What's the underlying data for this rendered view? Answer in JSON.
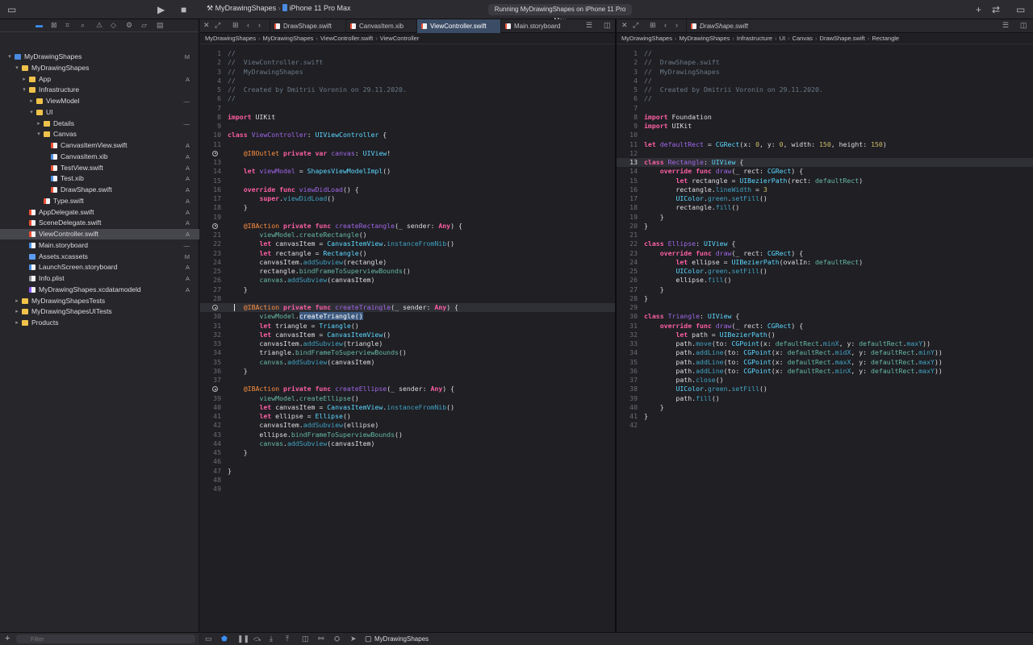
{
  "toolbar": {
    "scheme": "MyDrawingShapes",
    "device": "iPhone 11 Pro Max",
    "status": "Running MyDrawingShapes on iPhone 11 Pro Max"
  },
  "navigator": {
    "filter_placeholder": "Filter",
    "items": [
      {
        "label": "MyDrawingShapes",
        "badge": "M",
        "indent": 0,
        "icon": "proj",
        "tw": "▾"
      },
      {
        "label": "MyDrawingShapes",
        "badge": "",
        "indent": 1,
        "icon": "folder",
        "tw": "▾"
      },
      {
        "label": "App",
        "badge": "A",
        "indent": 2,
        "icon": "folder",
        "tw": "▸"
      },
      {
        "label": "Infrastructure",
        "badge": "",
        "indent": 2,
        "icon": "folder",
        "tw": "▾"
      },
      {
        "label": "ViewModel",
        "badge": "—",
        "indent": 3,
        "icon": "folder",
        "tw": "▸"
      },
      {
        "label": "UI",
        "badge": "",
        "indent": 3,
        "icon": "folder",
        "tw": "▾"
      },
      {
        "label": "Details",
        "badge": "—",
        "indent": 4,
        "icon": "folder",
        "tw": "▸"
      },
      {
        "label": "Canvas",
        "badge": "",
        "indent": 4,
        "icon": "folder",
        "tw": "▾"
      },
      {
        "label": "CanvasItemView.swift",
        "badge": "A",
        "indent": 5,
        "icon": "swift",
        "tw": ""
      },
      {
        "label": "CanvasItem.xib",
        "badge": "A",
        "indent": 5,
        "icon": "xib",
        "tw": ""
      },
      {
        "label": "TestView.swift",
        "badge": "A",
        "indent": 5,
        "icon": "swift",
        "tw": ""
      },
      {
        "label": "Test.xib",
        "badge": "A",
        "indent": 5,
        "icon": "xib",
        "tw": ""
      },
      {
        "label": "DrawShape.swift",
        "badge": "A",
        "indent": 5,
        "icon": "swift",
        "tw": ""
      },
      {
        "label": "Type.swift",
        "badge": "A",
        "indent": 4,
        "icon": "swift",
        "tw": ""
      },
      {
        "label": "AppDelegate.swift",
        "badge": "A",
        "indent": 2,
        "icon": "swift",
        "tw": ""
      },
      {
        "label": "SceneDelegate.swift",
        "badge": "A",
        "indent": 2,
        "icon": "swift",
        "tw": ""
      },
      {
        "label": "ViewController.swift",
        "badge": "A",
        "indent": 2,
        "icon": "swift",
        "tw": "",
        "selected": true
      },
      {
        "label": "Main.storyboard",
        "badge": "—",
        "indent": 2,
        "icon": "xib",
        "tw": ""
      },
      {
        "label": "Assets.xcassets",
        "badge": "M",
        "indent": 2,
        "icon": "assets",
        "tw": ""
      },
      {
        "label": "LaunchScreen.storyboard",
        "badge": "A",
        "indent": 2,
        "icon": "xib",
        "tw": ""
      },
      {
        "label": "Info.plist",
        "badge": "A",
        "indent": 2,
        "icon": "plist",
        "tw": ""
      },
      {
        "label": "MyDrawingShapes.xcdatamodeld",
        "badge": "A",
        "indent": 2,
        "icon": "data",
        "tw": ""
      },
      {
        "label": "MyDrawingShapesTests",
        "badge": "",
        "indent": 1,
        "icon": "folder",
        "tw": "▸"
      },
      {
        "label": "MyDrawingShapesUITests",
        "badge": "",
        "indent": 1,
        "icon": "folder",
        "tw": "▸"
      },
      {
        "label": "Products",
        "badge": "",
        "indent": 1,
        "icon": "folder",
        "tw": "▸"
      }
    ]
  },
  "left_editor": {
    "tabs": [
      {
        "label": "DrawShape.swift",
        "active": false
      },
      {
        "label": "CanvasItem.xib",
        "active": false
      },
      {
        "label": "ViewController.swift",
        "active": true
      },
      {
        "label": "Main.storyboard",
        "active": false
      }
    ],
    "breadcrumb": [
      "MyDrawingShapes",
      "MyDrawingShapes",
      "ViewController.swift",
      "ViewController"
    ],
    "current_line": 29,
    "breakpoint_lines": [
      12,
      20,
      29,
      38
    ],
    "lines": [
      "[c]//[/]",
      "[c]//  ViewController.swift[/]",
      "[c]//  MyDrawingShapes[/]",
      "[c]//[/]",
      "[c]//  Created by Dmitrii Voronin on 29.11.2020.[/]",
      "[c]//[/]",
      "",
      "[k]import[/] UIKit",
      "",
      "[k]class[/] [d]ViewController[/]: [t]UIViewController[/] {",
      "",
      "    [a]@IBOutlet[/] [k]private[/] [k]var[/] [d]canvas[/]: [t]UIView[/]!",
      "",
      "    [k]let[/] [d]viewModel[/] = [t]ShapesViewModelImpl[/]()",
      "",
      "    [k]override[/] [k]func[/] [d]viewDidLoad[/]() {",
      "        [k]super[/].[p]viewDidLoad[/]()",
      "    }",
      "",
      "    [a]@IBAction[/] [k]private[/] [k]func[/] [d]createRectangle[/](_ sender: [k]Any[/]) {",
      "        [f]viewModel[/].[f]createRectangle[/]()",
      "        [k]let[/] canvasItem = [t]CanvasItemView[/].[p]instanceFromNib[/]()",
      "        [k]let[/] rectangle = [t]Rectangle[/]()",
      "        canvasItem.[p]addSubview[/](rectangle)",
      "        rectangle.[f]bindFrameToSuperviewBounds[/]()",
      "        [f]canvas[/].[p]addSubview[/](canvasItem)",
      "    }",
      "",
      "    [a]@IBAction[/] [k]private[/] [k]func[/] [d]createTraingle[/](_ sender: [k]Any[/]) {",
      "        [f]viewModel[/].[h]createTriangle()[/]",
      "        [k]let[/] triangle = [t]Triangle[/]()",
      "        [k]let[/] canvasItem = [t]CanvasItemView[/]()",
      "        canvasItem.[p]addSubview[/](triangle)",
      "        triangle.[f]bindFrameToSuperviewBounds[/]()",
      "        [f]canvas[/].[p]addSubview[/](canvasItem)",
      "    }",
      "",
      "    [a]@IBAction[/] [k]private[/] [k]func[/] [d]createEllipse[/](_ sender: [k]Any[/]) {",
      "        [f]viewModel[/].[f]createEllipse[/]()",
      "        [k]let[/] canvasItem = [t]CanvasItemView[/].[p]instanceFromNib[/]()",
      "        [k]let[/] ellipse = [t]Ellipse[/]()",
      "        canvasItem.[p]addSubview[/](ellipse)",
      "        ellipse.[f]bindFrameToSuperviewBounds[/]()",
      "        [f]canvas[/].[p]addSubview[/](canvasItem)",
      "    }",
      "",
      "}",
      "",
      ""
    ]
  },
  "right_editor": {
    "tabs": [
      {
        "label": "DrawShape.swift",
        "active": false
      }
    ],
    "breadcrumb": [
      "MyDrawingShapes",
      "MyDrawingShapes",
      "Infrastructure",
      "UI",
      "Canvas",
      "DrawShape.swift",
      "Rectangle"
    ],
    "current_line": 13,
    "breakpoint_lines": [],
    "lines": [
      "[c]//[/]",
      "[c]//  DrawShape.swift[/]",
      "[c]//  MyDrawingShapes[/]",
      "[c]//[/]",
      "[c]//  Created by Dmitrii Voronin on 29.11.2020.[/]",
      "[c]//[/]",
      "",
      "[k]import[/] Foundation",
      "[k]import[/] UIKit",
      "",
      "[k]let[/] [d]defaultRect[/] = [t]CGRect[/](x: [n]0[/], y: [n]0[/], width: [n]150[/], height: [n]150[/])",
      "",
      "[k]class[/] [d]Rectangle[/]: [t]UIView[/] {",
      "    [k]override[/] [k]func[/] [d]draw[/](_ rect: [t]CGRect[/]) {",
      "        [k]let[/] rectangle = [t]UIBezierPath[/](rect: [f]defaultRect[/])",
      "        rectangle.[p]lineWidth[/] = [n]3[/]",
      "        [t]UIColor[/].[p]green[/].[p]setFill[/]()",
      "        rectangle.[p]fill[/]()",
      "    }",
      "}",
      "",
      "[k]class[/] [d]Ellipse[/]: [t]UIView[/] {",
      "    [k]override[/] [k]func[/] [d]draw[/](_ rect: [t]CGRect[/]) {",
      "        [k]let[/] ellipse = [t]UIBezierPath[/](ovalIn: [f]defaultRect[/])",
      "        [t]UIColor[/].[p]green[/].[p]setFill[/]()",
      "        ellipse.[p]fill[/]()",
      "    }",
      "}",
      "",
      "[k]class[/] [d]Triangle[/]: [t]UIView[/] {",
      "    [k]override[/] [k]func[/] [d]draw[/](_ rect: [t]CGRect[/]) {",
      "        [k]let[/] path = [t]UIBezierPath[/]()",
      "        path.[p]move[/](to: [t]CGPoint[/](x: [f]defaultRect[/].[p]minX[/], y: [f]defaultRect[/].[p]maxY[/]))",
      "        path.[p]addLine[/](to: [t]CGPoint[/](x: [f]defaultRect[/].[p]midX[/], y: [f]defaultRect[/].[p]minY[/]))",
      "        path.[p]addLine[/](to: [t]CGPoint[/](x: [f]defaultRect[/].[p]maxX[/], y: [f]defaultRect[/].[p]maxY[/]))",
      "        path.[p]addLine[/](to: [t]CGPoint[/](x: [f]defaultRect[/].[p]minX[/], y: [f]defaultRect[/].[p]maxY[/]))",
      "        path.[p]close[/]()",
      "        [t]UIColor[/].[p]green[/].[p]setFill[/]()",
      "        path.[p]fill[/]()",
      "    }",
      "}",
      ""
    ]
  },
  "debug_bar": {
    "target": "MyDrawingShapes"
  },
  "colors": {
    "keyword": "#fc5fa3",
    "comment": "#6c7986",
    "type": "#5dd8ff",
    "accent": "#3d8ef5"
  }
}
